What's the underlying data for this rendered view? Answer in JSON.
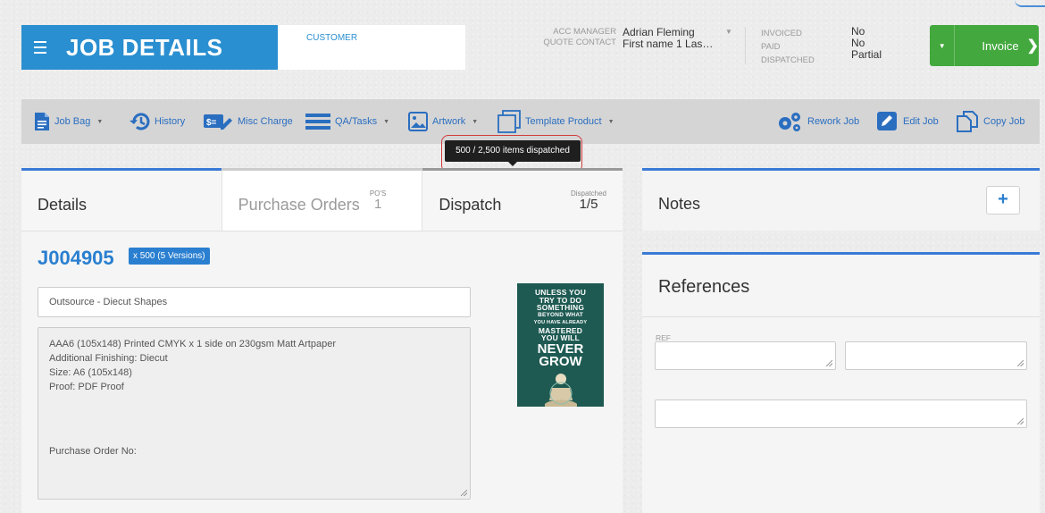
{
  "header": {
    "title": "JOB DETAILS",
    "customer_label": "CUSTOMER",
    "acc_manager_label": "ACC MANAGER",
    "quote_contact_label": "QUOTE CONTACT",
    "acc_manager_value": "Adrian Fleming",
    "quote_contact_value": "First name 1 Las…",
    "invoiced_label": "INVOICED",
    "paid_label": "PAID",
    "dispatched_label": "DISPATCHED",
    "invoiced_value": "No",
    "paid_value": "No",
    "dispatched_value": "Partial",
    "invoice_button": "Invoice"
  },
  "toolbar": {
    "job_bag": "Job Bag",
    "history": "History",
    "misc_charge": "Misc Charge",
    "qa_tasks": "QA/Tasks",
    "artwork": "Artwork",
    "template_product": "Template Product",
    "rework_job": "Rework Job",
    "edit_job": "Edit Job",
    "copy_job": "Copy Job"
  },
  "tooltip": {
    "text": "500 / 2,500 items dispatched"
  },
  "tabs": {
    "details": "Details",
    "purchase_orders": "Purchase Orders",
    "pos_label": "PO'S",
    "pos_count": "1",
    "dispatch": "Dispatch",
    "dispatched_label": "Dispatched",
    "dispatched_count": "1/5"
  },
  "job": {
    "id": "J004905",
    "quantity_badge": "x 500 (5 Versions)",
    "product": "Outsource - Diecut Shapes",
    "description_lines": [
      "AAA6 (105x148)  Printed CMYK x 1 side  on 230gsm Matt Artpaper",
      "Additional Finishing: Diecut",
      "Size: A6 (105x148)",
      "Proof: PDF Proof"
    ],
    "po_line": "Purchase Order No:"
  },
  "poster": {
    "small_lines": [
      "UNLESS YOU",
      "TRY TO DO",
      "SOMETHING",
      "BEYOND WHAT",
      "YOU HAVE ALREADY",
      "MASTERED",
      "YOU WILL"
    ],
    "big_lines": [
      "NEVER",
      "GROW"
    ]
  },
  "notes": {
    "title": "Notes",
    "add": "+"
  },
  "references": {
    "title": "References",
    "ref_label": "REF"
  },
  "colors": {
    "primary_blue": "#2a8fd0",
    "invoice_green": "#43a83e",
    "tab_accent": "#3a7ad6",
    "tooltip_ring": "#d23a3a"
  }
}
